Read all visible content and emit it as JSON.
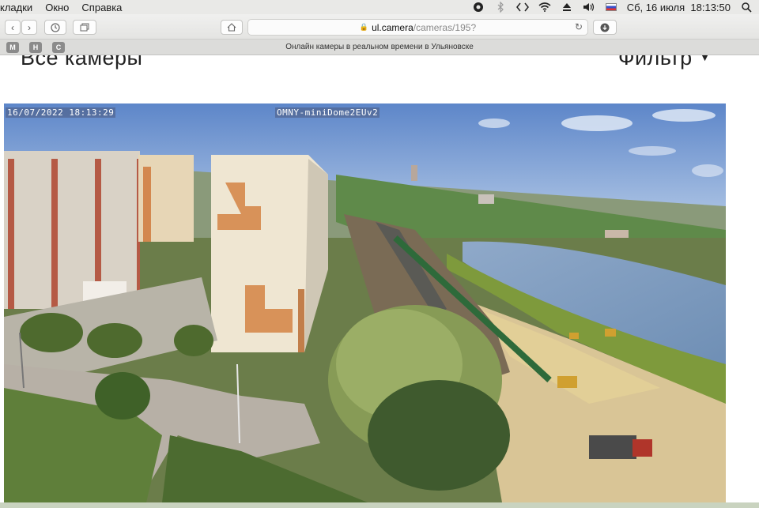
{
  "menubar": {
    "items": [
      "кладки",
      "Окно",
      "Справка"
    ],
    "date_time": "Сб, 16 июля  18:13:50"
  },
  "browser": {
    "url_host": "ul.camera",
    "url_path": "/cameras/195?",
    "tab_title": "Онлайн камеры в реальном времени в Ульяновске",
    "favorites": [
      "M",
      "H",
      "C"
    ]
  },
  "page": {
    "heading": "Все камеры",
    "filter_label": "Фильтр"
  },
  "camera": {
    "timestamp": "16/07/2022 18:13:29",
    "device": "OMNY-miniDome2EUv2"
  },
  "icons": [
    "search-icon",
    "wifi-icon",
    "volume-icon",
    "bluetooth-icon",
    "back-icon",
    "forward-icon",
    "history-icon",
    "tabs-icon",
    "home-icon",
    "lock-icon",
    "reload-icon",
    "download-icon",
    "dropdown-triangle-icon"
  ]
}
